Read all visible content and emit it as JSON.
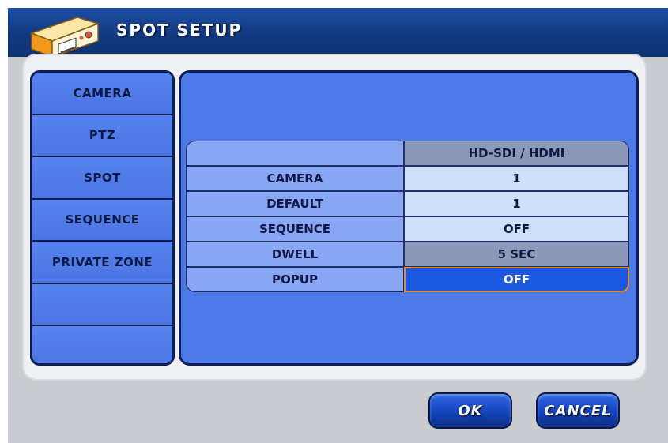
{
  "window": {
    "title": "SPOT SETUP"
  },
  "sidebar": {
    "items": [
      {
        "label": "CAMERA"
      },
      {
        "label": "PTZ"
      },
      {
        "label": "SPOT"
      },
      {
        "label": "SEQUENCE"
      },
      {
        "label": "PRIVATE ZONE"
      },
      {
        "label": ""
      },
      {
        "label": ""
      }
    ]
  },
  "table": {
    "header": {
      "label": "",
      "value": "HD-SDI / HDMI"
    },
    "rows": [
      {
        "label": "CAMERA",
        "value": "1"
      },
      {
        "label": "DEFAULT",
        "value": "1"
      },
      {
        "label": "SEQUENCE",
        "value": "OFF"
      },
      {
        "label": "DWELL",
        "value": "5 SEC"
      },
      {
        "label": "POPUP",
        "value": "OFF"
      }
    ]
  },
  "buttons": {
    "ok": "OK",
    "cancel": "CANCEL"
  },
  "colors": {
    "titlebar": "#123a82",
    "panel_blue": "#4d79e8",
    "selected_border": "#e78a2c",
    "selected_fill": "#1c57e0"
  }
}
